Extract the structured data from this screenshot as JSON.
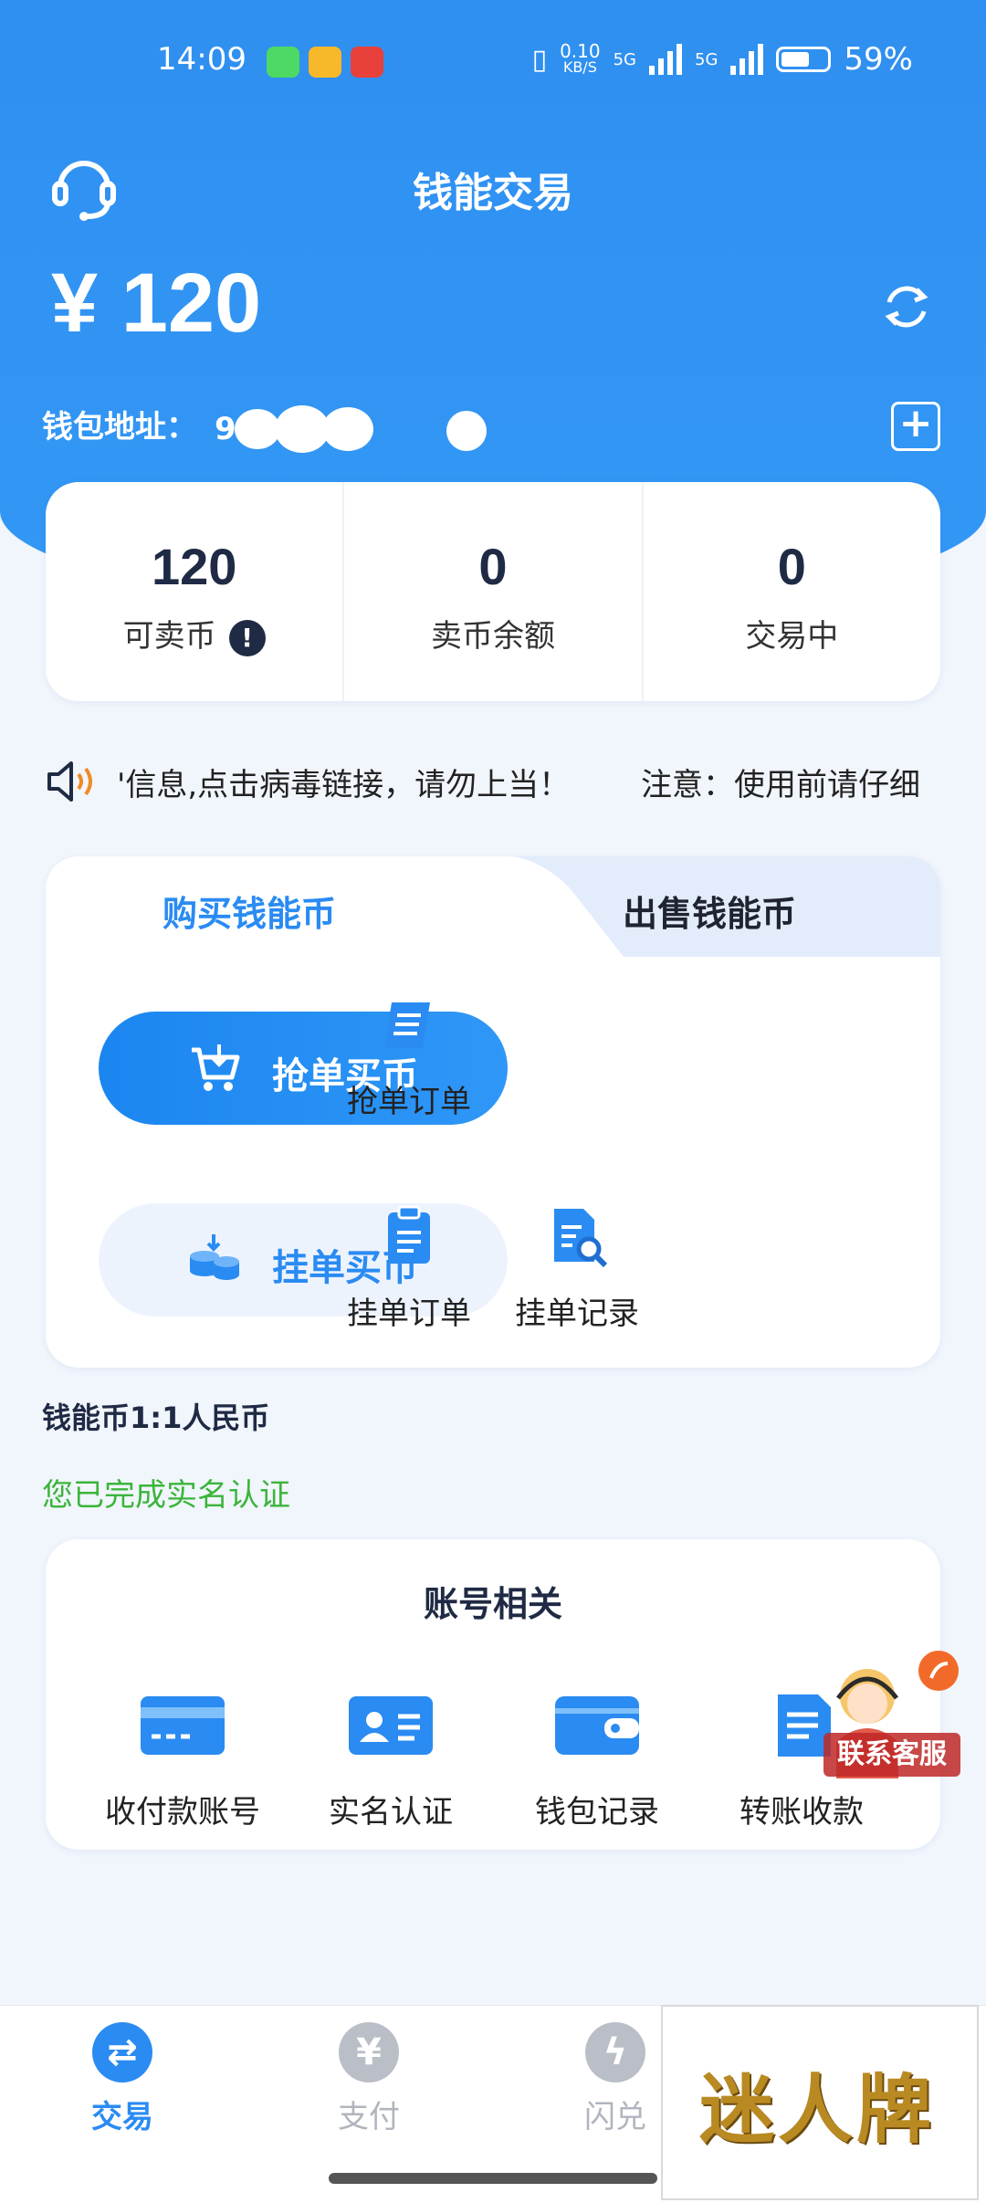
{
  "status_bar": {
    "time": "14:09",
    "net_speed_value": "0.10",
    "net_speed_unit": "KB/S",
    "network_1": "5G",
    "network_2": "5G",
    "battery": "59%"
  },
  "header": {
    "title": "钱能交易",
    "balance": "¥ 120",
    "wallet_label": "钱包地址：",
    "wallet_prefix": "9."
  },
  "stats": [
    {
      "value": "120",
      "label": "可卖币"
    },
    {
      "value": "0",
      "label": "卖币余额"
    },
    {
      "value": "0",
      "label": "交易中"
    }
  ],
  "notice": {
    "text": "'信息,点击病毒链接，请勿上当！",
    "text2": "注意：使用前请仔细"
  },
  "trade": {
    "tab_buy": "购买钱能币",
    "tab_sell": "出售钱能币",
    "grab_button": "抢单买币",
    "post_button": "挂单买币",
    "grab_orders": "抢单订单",
    "post_orders": "挂单订单",
    "post_records": "挂单记录"
  },
  "rate": "钱能币1:1人民币",
  "verified": "您已完成实名认证",
  "account": {
    "title": "账号相关",
    "items": [
      {
        "label": "收付款账号",
        "icon": "bank-card-icon"
      },
      {
        "label": "实名认证",
        "icon": "id-card-icon"
      },
      {
        "label": "钱包记录",
        "icon": "wallet-icon"
      },
      {
        "label": "转账收款",
        "icon": "transfer-document-icon"
      }
    ]
  },
  "customer_service": {
    "label": "联系客服"
  },
  "tabbar": [
    {
      "label": "交易",
      "icon": "exchange-icon",
      "active": true
    },
    {
      "label": "支付",
      "icon": "yuan-icon",
      "active": false
    },
    {
      "label": "闪兑",
      "icon": "lightning-icon",
      "active": false
    }
  ],
  "watermark": "迷人牌",
  "colors": {
    "primary": "#2a8bf2",
    "background": "#f1f5fc",
    "verified": "#3bb53b"
  }
}
